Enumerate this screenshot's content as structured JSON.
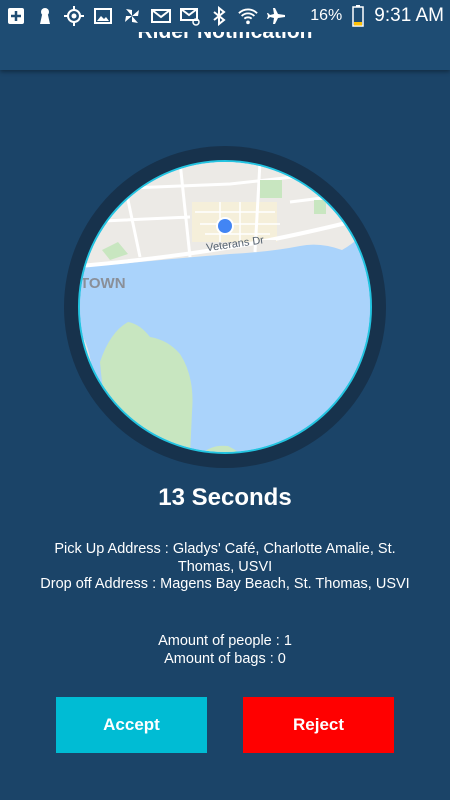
{
  "status_bar": {
    "icons": [
      "add-box-icon",
      "keyhole-icon",
      "gps-icon",
      "image-icon",
      "pinwheel-icon",
      "mail-icon",
      "email-at-icon",
      "bluetooth-icon",
      "wifi-icon",
      "airplane-icon",
      "battery-icon"
    ],
    "battery": "16%",
    "time": "9:31 AM"
  },
  "header": {
    "title": "Rider Notification"
  },
  "map": {
    "street_label": "Veterans Dr",
    "town_label": "TOWN"
  },
  "timer": "13 Seconds",
  "details": {
    "pickup": "Pick Up Address : Gladys' Café, Charlotte Amalie, St. Thomas, USVI",
    "dropoff": "Drop off Address : Magens Bay Beach, St. Thomas, USVI"
  },
  "counts": {
    "people": "Amount of people : 1",
    "bags": "Amount of bags : 0"
  },
  "actions": {
    "accept_label": "Accept",
    "reject_label": "Reject"
  },
  "colors": {
    "background": "#1b4468",
    "accent": "#00bcd4",
    "reject": "#ff0000",
    "water": "#aad3fb"
  }
}
